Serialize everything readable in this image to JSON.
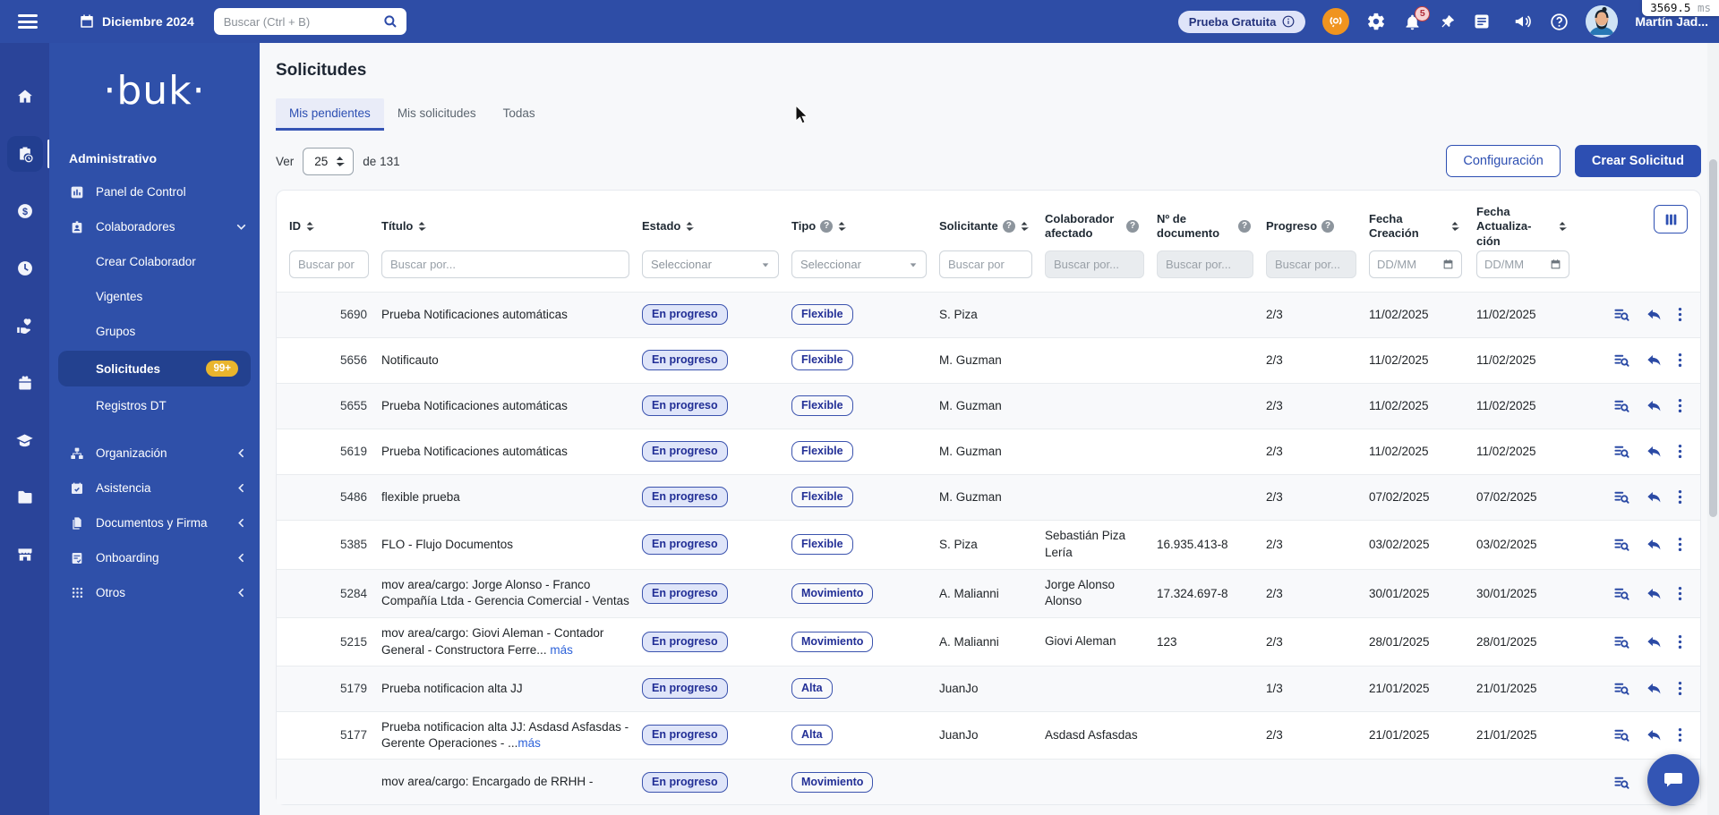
{
  "perf_overlay": {
    "value": "3569.5",
    "unit": "ms"
  },
  "topbar": {
    "date": "Diciembre 2024",
    "search_placeholder": "Buscar (Ctrl + B)",
    "trial_label": "Prueba Gratuita",
    "notification_count": "5",
    "user_name": "Martín Jad...",
    "icons": [
      "hamburger",
      "calendar",
      "search",
      "live-support",
      "gear",
      "bell",
      "pin",
      "note",
      "megaphone",
      "help",
      "avatar"
    ]
  },
  "sidebar": {
    "brand": "·buk·",
    "section": "Administrativo",
    "rail_icons": [
      "home",
      "clipboard-clock",
      "money",
      "clock",
      "hand-heart",
      "gift",
      "graduation-cap",
      "folder",
      "storefront"
    ],
    "menu": [
      {
        "label": "Panel de Control",
        "icon": "bar-chart"
      },
      {
        "label": "Colaboradores",
        "icon": "id-badge",
        "state": "expanded"
      },
      {
        "label": "Crear Colaborador"
      },
      {
        "label": "Vigentes"
      },
      {
        "label": "Grupos"
      },
      {
        "label": "Solicitudes",
        "badge": "99+",
        "state": "active"
      },
      {
        "label": "Registros DT"
      },
      {
        "label": "Organización",
        "icon": "org-chart",
        "state": "collapsed"
      },
      {
        "label": "Asistencia",
        "icon": "calendar-check",
        "state": "collapsed"
      },
      {
        "label": "Documentos y Firma",
        "icon": "documents",
        "state": "collapsed"
      },
      {
        "label": "Onboarding",
        "icon": "clipboard-check",
        "state": "collapsed"
      },
      {
        "label": "Otros",
        "icon": "grid",
        "state": "collapsed"
      }
    ]
  },
  "page": {
    "title": "Solicitudes",
    "tabs": [
      {
        "label": "Mis pendientes",
        "active": true
      },
      {
        "label": "Mis solicitudes",
        "active": false
      },
      {
        "label": "Todas",
        "active": false
      }
    ],
    "ver_label": "Ver",
    "page_size": "25",
    "total_label": "de 131",
    "config_button": "Configuración",
    "create_button": "Crear Solicitud"
  },
  "table": {
    "columns": [
      {
        "label": "ID"
      },
      {
        "label": "Título"
      },
      {
        "label": "Estado"
      },
      {
        "label": "Tipo"
      },
      {
        "label": "Solicitante"
      },
      {
        "label": "Colaborador afectado"
      },
      {
        "label": "Nº de documento"
      },
      {
        "label": "Progreso"
      },
      {
        "label": "Fecha Creación"
      },
      {
        "label": "Fecha Actualiza-ción"
      }
    ],
    "filters": {
      "id": "Buscar por",
      "titulo": "Buscar por...",
      "estado": "Seleccionar",
      "tipo": "Seleccionar",
      "solicitante": "Buscar por",
      "colaborador": "Buscar por...",
      "documento": "Buscar por...",
      "progreso": "Buscar por...",
      "fecha_creacion": "DD/MM",
      "fecha_actualizacion": "DD/MM"
    },
    "rows": [
      {
        "id": "5690",
        "title": "Prueba Notificaciones automáticas",
        "more": "",
        "estado": "En progreso",
        "tipo": "Flexible",
        "solicitante": "S. Piza",
        "colaborador": "",
        "documento": "",
        "progreso": "2/3",
        "creacion": "11/02/2025",
        "actualizacion": "11/02/2025"
      },
      {
        "id": "5656",
        "title": "Notificauto",
        "more": "",
        "estado": "En progreso",
        "tipo": "Flexible",
        "solicitante": "M. Guzman",
        "colaborador": "",
        "documento": "",
        "progreso": "2/3",
        "creacion": "11/02/2025",
        "actualizacion": "11/02/2025"
      },
      {
        "id": "5655",
        "title": "Prueba Notificaciones automáticas",
        "more": "",
        "estado": "En progreso",
        "tipo": "Flexible",
        "solicitante": "M. Guzman",
        "colaborador": "",
        "documento": "",
        "progreso": "2/3",
        "creacion": "11/02/2025",
        "actualizacion": "11/02/2025"
      },
      {
        "id": "5619",
        "title": "Prueba Notificaciones automáticas",
        "more": "",
        "estado": "En progreso",
        "tipo": "Flexible",
        "solicitante": "M. Guzman",
        "colaborador": "",
        "documento": "",
        "progreso": "2/3",
        "creacion": "11/02/2025",
        "actualizacion": "11/02/2025"
      },
      {
        "id": "5486",
        "title": "flexible prueba",
        "more": "",
        "estado": "En progreso",
        "tipo": "Flexible",
        "solicitante": "M. Guzman",
        "colaborador": "",
        "documento": "",
        "progreso": "2/3",
        "creacion": "07/02/2025",
        "actualizacion": "07/02/2025"
      },
      {
        "id": "5385",
        "title": "FLO - Flujo Documentos",
        "more": "",
        "estado": "En progreso",
        "tipo": "Flexible",
        "solicitante": "S. Piza",
        "colaborador": "Sebastián Piza Lería",
        "documento": "16.935.413-8",
        "progreso": "2/3",
        "creacion": "03/02/2025",
        "actualizacion": "03/02/2025"
      },
      {
        "id": "5284",
        "title": "mov area/cargo: Jorge Alonso - Franco Compañía Ltda - Gerencia Comercial - Ventas",
        "more": "",
        "estado": "En progreso",
        "tipo": "Movimiento",
        "solicitante": "A. Malianni",
        "colaborador": "Jorge Alonso Alonso",
        "documento": "17.324.697-8",
        "progreso": "2/3",
        "creacion": "30/01/2025",
        "actualizacion": "30/01/2025"
      },
      {
        "id": "5215",
        "title": "mov area/cargo: Giovi Aleman - Contador General - Constructora Ferre... ",
        "more": "más",
        "estado": "En progreso",
        "tipo": "Movimiento",
        "solicitante": "A. Malianni",
        "colaborador": "Giovi Aleman",
        "documento": "123",
        "progreso": "2/3",
        "creacion": "28/01/2025",
        "actualizacion": "28/01/2025"
      },
      {
        "id": "5179",
        "title": "Prueba notificacion alta JJ",
        "more": "",
        "estado": "En progreso",
        "tipo": "Alta",
        "solicitante": "JuanJo",
        "colaborador": "",
        "documento": "",
        "progreso": "1/3",
        "creacion": "21/01/2025",
        "actualizacion": "21/01/2025"
      },
      {
        "id": "5177",
        "title": "Prueba notificacion alta JJ: Asdasd Asfasdas - Gerente Operaciones - ...",
        "more": "más",
        "estado": "En progreso",
        "tipo": "Alta",
        "solicitante": "JuanJo",
        "colaborador": "Asdasd Asfasdas",
        "documento": "",
        "progreso": "2/3",
        "creacion": "21/01/2025",
        "actualizacion": "21/01/2025"
      },
      {
        "id": "",
        "title": "mov area/cargo: Encargado de RRHH -",
        "more": "",
        "estado": "En progreso",
        "tipo": "Movimiento",
        "solicitante": "",
        "colaborador": "",
        "documento": "",
        "progreso": "",
        "creacion": "",
        "actualizacion": ""
      }
    ]
  },
  "colors": {
    "topbar": "#2e4da6",
    "rail": "#2a4499",
    "sidebar": "#2f50a9",
    "accent": "#2d4fb2",
    "pill_fill": "#dfe5f9",
    "badge_yellow": "#e9b52d",
    "live_orange": "#f0941f"
  }
}
